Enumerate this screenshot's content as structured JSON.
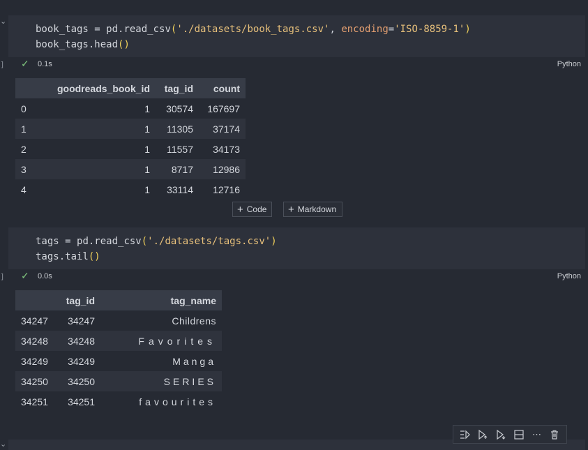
{
  "cell1": {
    "line1": {
      "var": "book_tags",
      "eq": " = ",
      "fn": "pd.read_csv",
      "open": "(",
      "path": "'./datasets/book_tags.csv'",
      "comma": ", ",
      "kw": "encoding",
      "eq2": "=",
      "enc": "'ISO-8859-1'",
      "close": ")"
    },
    "line2": {
      "text": "book_tags.head",
      "parens": "()"
    },
    "exec_time": "0.1s",
    "language": "Python"
  },
  "table1": {
    "headers": [
      "",
      "goodreads_book_id",
      "tag_id",
      "count"
    ],
    "rows": [
      [
        "0",
        "1",
        "30574",
        "167697"
      ],
      [
        "1",
        "1",
        "11305",
        "37174"
      ],
      [
        "2",
        "1",
        "11557",
        "34173"
      ],
      [
        "3",
        "1",
        "8717",
        "12986"
      ],
      [
        "4",
        "1",
        "33114",
        "12716"
      ]
    ]
  },
  "add_buttons": {
    "code_label": "Code",
    "markdown_label": "Markdown"
  },
  "cell2": {
    "line1": {
      "var": "tags",
      "eq": " = ",
      "fn": "pd.read_csv",
      "open": "(",
      "path": "'./datasets/tags.csv'",
      "close": ")"
    },
    "line2": {
      "text": "tags.tail",
      "parens": "()"
    },
    "exec_time": "0.0s",
    "language": "Python"
  },
  "table2": {
    "headers": [
      "",
      "tag_id",
      "tag_name"
    ],
    "rows": [
      [
        "34247",
        "34247",
        "Childrens"
      ],
      [
        "34248",
        "34248",
        "Favorites"
      ],
      [
        "34249",
        "34249",
        "Manga"
      ],
      [
        "34250",
        "34250",
        "SERIES"
      ],
      [
        "34251",
        "34251",
        "favourites"
      ]
    ]
  },
  "toolbar": {
    "icons": [
      "run-above-icon",
      "run-below-icon",
      "run-cell-icon",
      "split-cell-icon",
      "more-icon",
      "delete-icon"
    ],
    "more_glyph": "⋯"
  },
  "gutter": {
    "chevron": "⌄",
    "bracket": "]"
  }
}
